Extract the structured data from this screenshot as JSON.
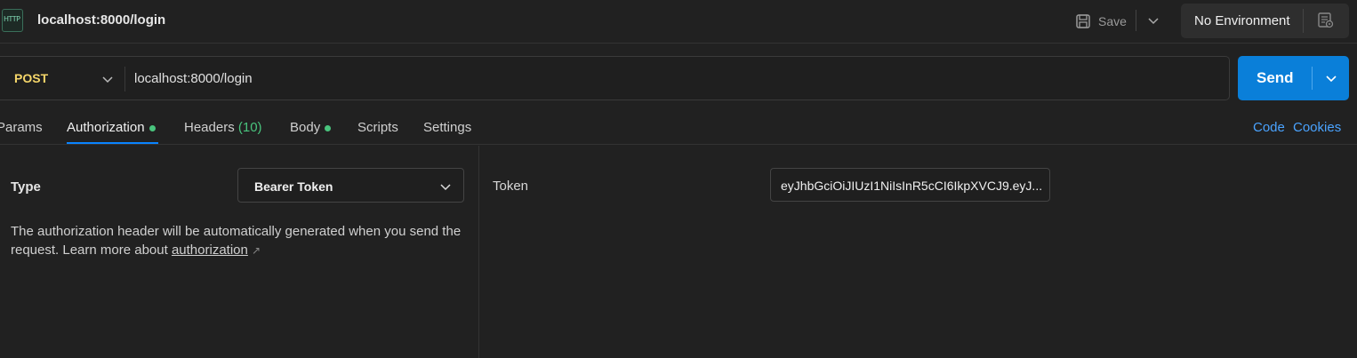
{
  "window": {
    "tab_icon": "http-request-icon",
    "tab_icon_text": "HTTP",
    "tab_title": "localhost:8000/login",
    "save_label": "Save",
    "environment_label": "No Environment"
  },
  "request": {
    "method": "POST",
    "url": "localhost:8000/login",
    "send_label": "Send"
  },
  "tabs": [
    {
      "label": "Params"
    },
    {
      "label": "Authorization",
      "dot": true,
      "active": true
    },
    {
      "label": "Headers",
      "count": "(10)"
    },
    {
      "label": "Body",
      "dot": true
    },
    {
      "label": "Scripts"
    },
    {
      "label": "Settings"
    }
  ],
  "links": {
    "code": "Code",
    "cookies": "Cookies"
  },
  "auth": {
    "type_label": "Type",
    "type_value": "Bearer Token",
    "description_prefix": "The authorization header will be automatically generated when you send the request. Learn more about ",
    "description_link": "authorization",
    "description_link_icon": "↗",
    "token_label": "Token",
    "token_value": "eyJhbGciOiJIUzI1NiIsInR5cCI6IkpXVCJ9.eyJ..."
  },
  "colors": {
    "accent": "#0a7fd9",
    "method_post": "#f5d66a",
    "status_dot": "#49c47d",
    "link": "#4aa3ff"
  }
}
